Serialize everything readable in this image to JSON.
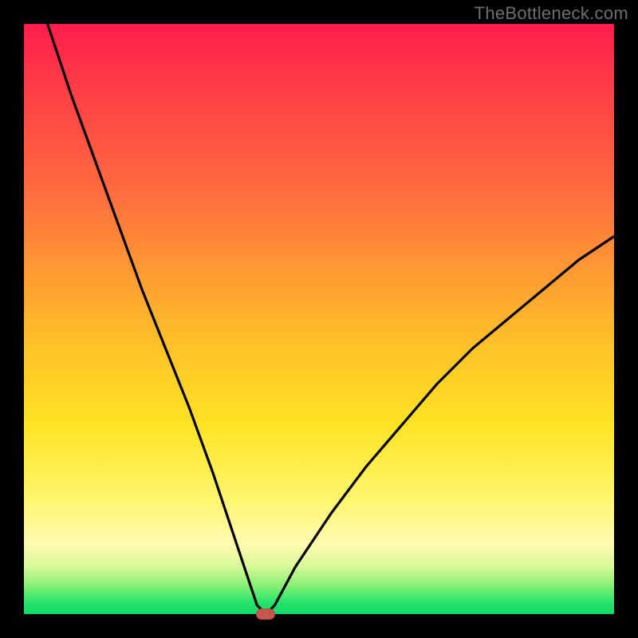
{
  "watermark": "TheBottleneck.com",
  "colors": {
    "frame": "#000000",
    "curve": "#000000",
    "marker": "#c6574e",
    "gradient_stops": [
      {
        "pct": 0,
        "hex": "#ff1d4d"
      },
      {
        "pct": 10,
        "hex": "#ff3b47"
      },
      {
        "pct": 28,
        "hex": "#ff6a3f"
      },
      {
        "pct": 42,
        "hex": "#ff9a33"
      },
      {
        "pct": 55,
        "hex": "#ffc328"
      },
      {
        "pct": 68,
        "hex": "#ffe325"
      },
      {
        "pct": 80,
        "hex": "#fff56a"
      },
      {
        "pct": 88,
        "hex": "#fffbb0"
      },
      {
        "pct": 92,
        "hex": "#d8f99a"
      },
      {
        "pct": 95,
        "hex": "#8ef077"
      },
      {
        "pct": 98,
        "hex": "#28e56b"
      },
      {
        "pct": 100,
        "hex": "#0fd968"
      }
    ]
  },
  "chart_data": {
    "type": "line",
    "title": "",
    "xlabel": "",
    "ylabel": "",
    "xlim": [
      0,
      100
    ],
    "ylim": [
      0,
      100
    ],
    "note": "V-shaped bottleneck curve. Minimum (~0) at x≈41; left branch rises steeply to ~100 at x=4, right branch rises to ~64 at x=100. Values estimated from pixel positions; axes are unlabeled in the source image so x and y are normalized 0-100.",
    "x": [
      4,
      8,
      12,
      16,
      20,
      24,
      28,
      32,
      35,
      38,
      39.5,
      41,
      42.5,
      46,
      52,
      58,
      64,
      70,
      76,
      82,
      88,
      94,
      100
    ],
    "y": [
      100,
      88,
      77,
      66,
      55,
      45,
      35,
      24,
      15,
      6,
      1.5,
      0,
      1.5,
      8,
      17,
      25,
      32,
      39,
      45,
      50,
      55,
      60,
      64
    ],
    "marker": {
      "x": 41,
      "y": 0
    }
  }
}
